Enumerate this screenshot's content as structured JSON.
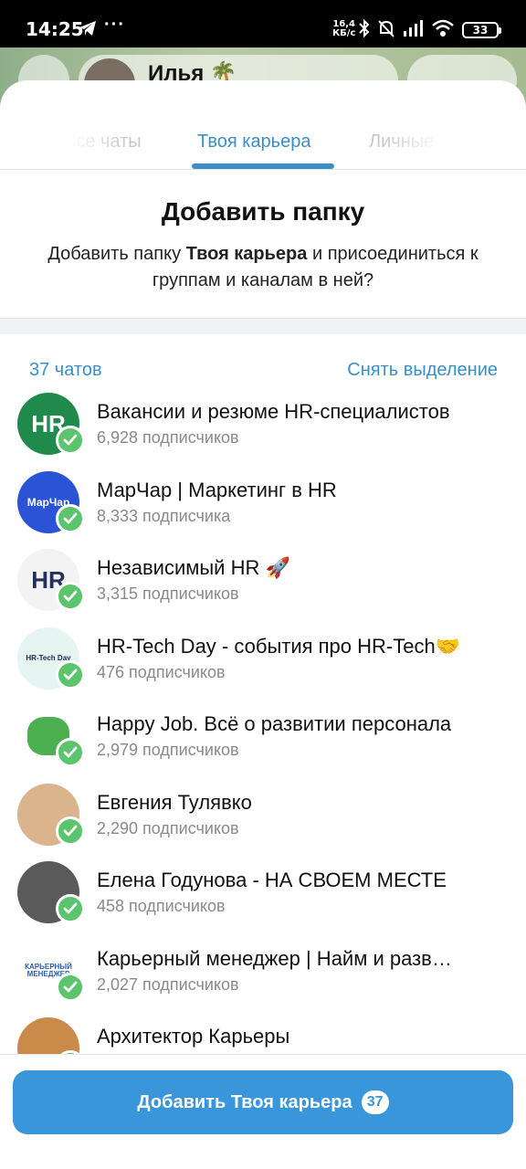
{
  "status_bar": {
    "time": "14:25",
    "dots": "···",
    "speed_top": "16,4",
    "speed_bottom": "КБ/с",
    "battery": "33"
  },
  "background_chat": {
    "name": "Илья 🌴"
  },
  "tabs": [
    {
      "label": "Все чаты"
    },
    {
      "label": "Твоя карьера"
    },
    {
      "label": "Личные"
    }
  ],
  "dialog": {
    "title": "Добавить папку",
    "desc_prefix": "Добавить папку ",
    "desc_bold": "Твоя карьера",
    "desc_suffix": " и присоединиться к группам и каналам в ней?"
  },
  "list_header": {
    "count": "37 чатов",
    "deselect": "Снять выделение"
  },
  "chats": [
    {
      "name": "Вакансии и резюме HR-специалистов",
      "subs": "6,928 подписчиков",
      "avatar_text": "HR",
      "avatar_bg": "#1f8a4c",
      "avatar_fg": "#ffffff"
    },
    {
      "name": "МарЧар | Маркетинг в HR",
      "subs": "8,333 подписчика",
      "avatar_text": "МарЧар",
      "avatar_bg": "#2a53d6",
      "avatar_fg": "#ffffff"
    },
    {
      "name": "Независимый HR 🚀",
      "subs": "3,315 подписчиков",
      "avatar_text": "HR",
      "avatar_bg": "#f3f3f3",
      "avatar_fg": "#23315f"
    },
    {
      "name": "HR-Tech Day - события про HR-Tech🤝",
      "subs": "476 подписчиков",
      "avatar_text": "HR-Tech Day",
      "avatar_bg": "#e6f4f2",
      "avatar_fg": "#1b2d55"
    },
    {
      "name": "Happy Job. Всё о развитии персонала",
      "subs": "2,979 подписчиков",
      "avatar_text": "",
      "avatar_bg": "#ffffff",
      "avatar_fg": "#4caf50"
    },
    {
      "name": "Евгения Тулявко",
      "subs": "2,290 подписчиков",
      "avatar_text": "",
      "avatar_bg": "#d9b48c",
      "avatar_fg": "#ffffff"
    },
    {
      "name": "Елена Годунова - НА СВОЕМ МЕСТЕ",
      "subs": "458 подписчиков",
      "avatar_text": "",
      "avatar_bg": "#5a5a5a",
      "avatar_fg": "#ffffff"
    },
    {
      "name": "Карьерный менеджер | Найм и разв…",
      "subs": "2,027 подписчиков",
      "avatar_text": "КАРЬЕРНЫЙ МЕНЕДЖЕР",
      "avatar_bg": "#ffffff",
      "avatar_fg": "#2b5fb0"
    },
    {
      "name": "Архитектор Карьеры",
      "subs": "",
      "avatar_text": "",
      "avatar_bg": "#c98a4a",
      "avatar_fg": "#ffffff"
    }
  ],
  "action": {
    "label": "Добавить Твоя карьера",
    "badge": "37"
  },
  "colors": {
    "accent": "#3a8fca",
    "button": "#3a96da",
    "check": "#5bc46c"
  }
}
